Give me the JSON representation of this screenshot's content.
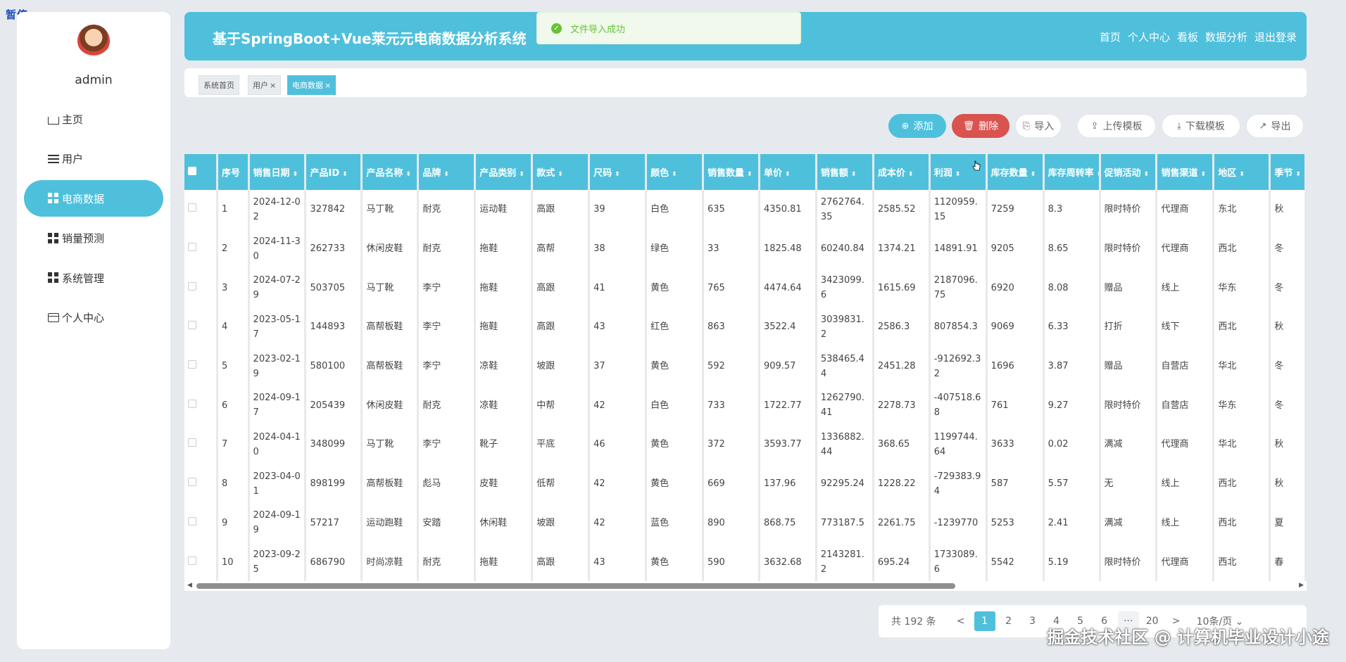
{
  "corner_label": "暂停",
  "sidebar": {
    "username": "admin",
    "items": [
      {
        "label": "主页",
        "icon": "home-icon",
        "active": false
      },
      {
        "label": "用户",
        "icon": "list-icon",
        "active": false
      },
      {
        "label": "电商数据",
        "icon": "grid-icon",
        "active": true
      },
      {
        "label": "销量预测",
        "icon": "grid-icon",
        "active": false
      },
      {
        "label": "系统管理",
        "icon": "grid-icon",
        "active": false
      },
      {
        "label": "个人中心",
        "icon": "card-icon",
        "active": false
      }
    ]
  },
  "header": {
    "title": "基于SpringBoot+Vue莱元元电商数据分析系统",
    "nav": [
      "首页",
      "个人中心",
      "看板",
      "数据分析",
      "退出登录"
    ]
  },
  "toast": {
    "message": "文件导入成功",
    "icon": "check-circle-icon"
  },
  "tabs": [
    {
      "label": "系统首页",
      "closable": false,
      "active": false
    },
    {
      "label": "用户",
      "closable": true,
      "active": false
    },
    {
      "label": "电商数据",
      "closable": true,
      "active": true
    }
  ],
  "toolbar": {
    "add": "添加",
    "delete": "删除",
    "import": "导入",
    "upload_template": "上传模板",
    "download_template": "下载模板",
    "export": "导出"
  },
  "table": {
    "columns": [
      "序号",
      "销售日期",
      "产品ID",
      "产品名称",
      "品牌",
      "产品类别",
      "款式",
      "尺码",
      "颜色",
      "销售数量",
      "单价",
      "销售额",
      "成本价",
      "利润",
      "库存数量",
      "库存周转率",
      "促销活动",
      "销售渠道",
      "地区",
      "季节"
    ],
    "rows": [
      [
        "1",
        "2024-12-02",
        "327842",
        "马丁靴",
        "耐克",
        "运动鞋",
        "高跟",
        "39",
        "白色",
        "635",
        "4350.81",
        "2762764.35",
        "2585.52",
        "1120959.15",
        "7259",
        "8.3",
        "限时特价",
        "代理商",
        "东北",
        "秋"
      ],
      [
        "2",
        "2024-11-30",
        "262733",
        "休闲皮鞋",
        "耐克",
        "拖鞋",
        "高帮",
        "38",
        "绿色",
        "33",
        "1825.48",
        "60240.84",
        "1374.21",
        "14891.91",
        "9205",
        "8.65",
        "限时特价",
        "代理商",
        "西北",
        "冬"
      ],
      [
        "3",
        "2024-07-29",
        "503705",
        "马丁靴",
        "李宁",
        "拖鞋",
        "高跟",
        "41",
        "黄色",
        "765",
        "4474.64",
        "3423099.6",
        "1615.69",
        "2187096.75",
        "6920",
        "8.08",
        "赠品",
        "线上",
        "华东",
        "冬"
      ],
      [
        "4",
        "2023-05-17",
        "144893",
        "高帮板鞋",
        "李宁",
        "拖鞋",
        "高跟",
        "43",
        "红色",
        "863",
        "3522.4",
        "3039831.2",
        "2586.3",
        "807854.3",
        "9069",
        "6.33",
        "打折",
        "线下",
        "西北",
        "秋"
      ],
      [
        "5",
        "2023-02-19",
        "580100",
        "高帮板鞋",
        "李宁",
        "凉鞋",
        "坡跟",
        "37",
        "黄色",
        "592",
        "909.57",
        "538465.44",
        "2451.28",
        "-912692.32",
        "1696",
        "3.87",
        "赠品",
        "自营店",
        "华北",
        "冬"
      ],
      [
        "6",
        "2024-09-17",
        "205439",
        "休闲皮鞋",
        "耐克",
        "凉鞋",
        "中帮",
        "42",
        "白色",
        "733",
        "1722.77",
        "1262790.41",
        "2278.73",
        "-407518.68",
        "761",
        "9.27",
        "限时特价",
        "自营店",
        "华东",
        "冬"
      ],
      [
        "7",
        "2024-04-10",
        "348099",
        "马丁靴",
        "李宁",
        "靴子",
        "平底",
        "46",
        "黄色",
        "372",
        "3593.77",
        "1336882.44",
        "368.65",
        "1199744.64",
        "3633",
        "0.02",
        "满减",
        "代理商",
        "华北",
        "秋"
      ],
      [
        "8",
        "2023-04-01",
        "898199",
        "高帮板鞋",
        "彪马",
        "皮鞋",
        "低帮",
        "42",
        "黄色",
        "669",
        "137.96",
        "92295.24",
        "1228.22",
        "-729383.94",
        "587",
        "5.57",
        "无",
        "线上",
        "西北",
        "秋"
      ],
      [
        "9",
        "2024-09-19",
        "57217",
        "运动跑鞋",
        "安踏",
        "休闲鞋",
        "坡跟",
        "42",
        "蓝色",
        "890",
        "868.75",
        "773187.5",
        "2261.75",
        "-1239770",
        "5253",
        "2.41",
        "满减",
        "线上",
        "西北",
        "夏"
      ],
      [
        "10",
        "2023-09-25",
        "686790",
        "时尚凉鞋",
        "耐克",
        "拖鞋",
        "高跟",
        "43",
        "黄色",
        "590",
        "3632.68",
        "2143281.2",
        "695.24",
        "1733089.6",
        "5542",
        "5.19",
        "限时特价",
        "代理商",
        "西北",
        "春"
      ]
    ]
  },
  "pagination": {
    "total_text": "共 192 条",
    "prev": "<",
    "pages": [
      "1",
      "2",
      "3",
      "4",
      "5",
      "6",
      "···",
      "20"
    ],
    "current": "1",
    "next": ">",
    "page_size": "10条/页"
  },
  "watermark": "掘金技术社区 @ 计算机毕业设计小途",
  "colors": {
    "accent": "#4fc0dc",
    "danger": "#d9534f",
    "success": "#67c23a"
  }
}
